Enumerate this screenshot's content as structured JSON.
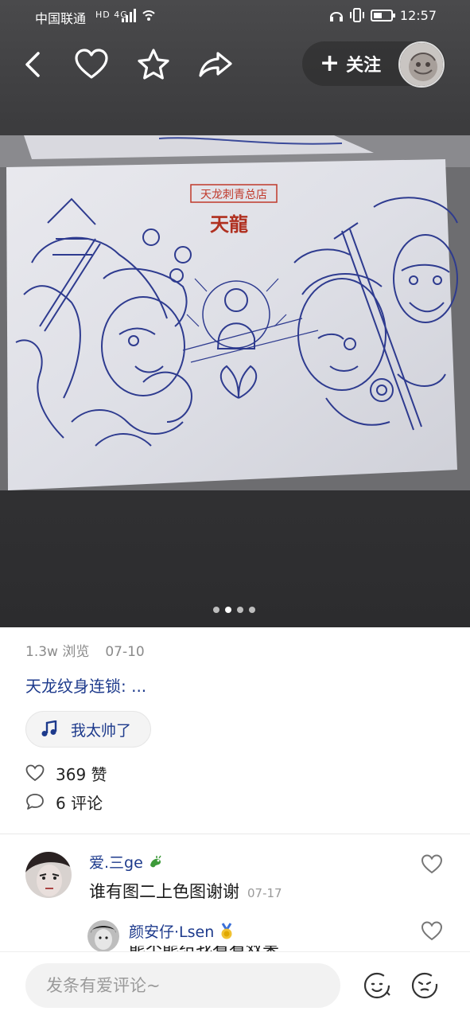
{
  "status_bar": {
    "carrier": "中国联通",
    "network_badges": "HD 4G",
    "time": "12:57"
  },
  "header": {
    "follow_label": "关注",
    "follow_plus": "+"
  },
  "post": {
    "image_sign_label": "天龙刺青总店",
    "image_calligraphy": "天龍",
    "pager": {
      "count": 4,
      "active_index": 1
    },
    "views": "1.3w 浏览",
    "date": "07-10",
    "title": "天龙纹身连锁: ...",
    "music": "我太帅了",
    "likes": "369 赞",
    "comments": "6 评论"
  },
  "comments": [
    {
      "name": "爱.三ge",
      "badge_icon": "dragon-emoji",
      "text": "谁有图二上色图谢谢",
      "date": "07-17"
    },
    {
      "name": "颜安仔·Lsen",
      "badge_icon": "medal-emoji",
      "text_partial": "能不能给我看看效果"
    }
  ],
  "bottom_bar": {
    "input_placeholder": "发条有爱评论~"
  },
  "colors": {
    "link_blue": "#1d3a8c",
    "muted_gray": "#8a8a8a",
    "sketch_ink": "#2e3b8f",
    "sign_red": "#c0392b"
  },
  "icons": [
    "back-icon",
    "heart-icon",
    "star-icon",
    "share-icon",
    "music-note-icon",
    "comment-bubble-icon",
    "emoji-face-icon",
    "mention-face-icon"
  ]
}
